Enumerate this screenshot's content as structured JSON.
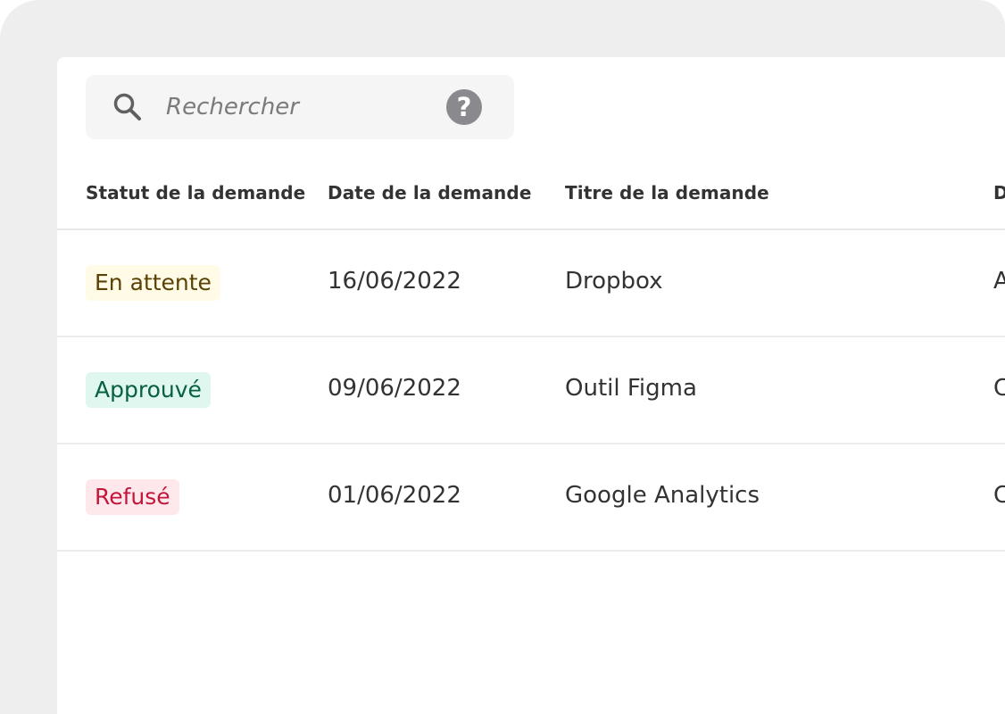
{
  "search": {
    "placeholder": "Rechercher",
    "icon": "search-icon",
    "help_icon_glyph": "?"
  },
  "table": {
    "columns": [
      {
        "label": "Statut de la demande"
      },
      {
        "label": "Date de la demande"
      },
      {
        "label": "Titre de la demande"
      },
      {
        "label": "D"
      }
    ],
    "rows": [
      {
        "status": "En attente",
        "status_bg": "#fffbe6",
        "status_color": "#5a4205",
        "date": "16/06/2022",
        "title": "Dropbox",
        "extra": "A"
      },
      {
        "status": "Approuvé",
        "status_bg": "#dff7ef",
        "status_color": "#07603f",
        "date": "09/06/2022",
        "title": "Outil Figma",
        "extra": "C"
      },
      {
        "status": "Refusé",
        "status_bg": "#ffe8ec",
        "status_color": "#c2163b",
        "date": "01/06/2022",
        "title": "Google Analytics",
        "extra": "C"
      }
    ]
  },
  "colors": {
    "frame_background": "#eeeeee",
    "panel_background": "#ffffff",
    "search_background": "#f5f5f5",
    "text": "#333333",
    "muted_text": "#7b7b7b",
    "help_icon": "#8a8a8e"
  }
}
